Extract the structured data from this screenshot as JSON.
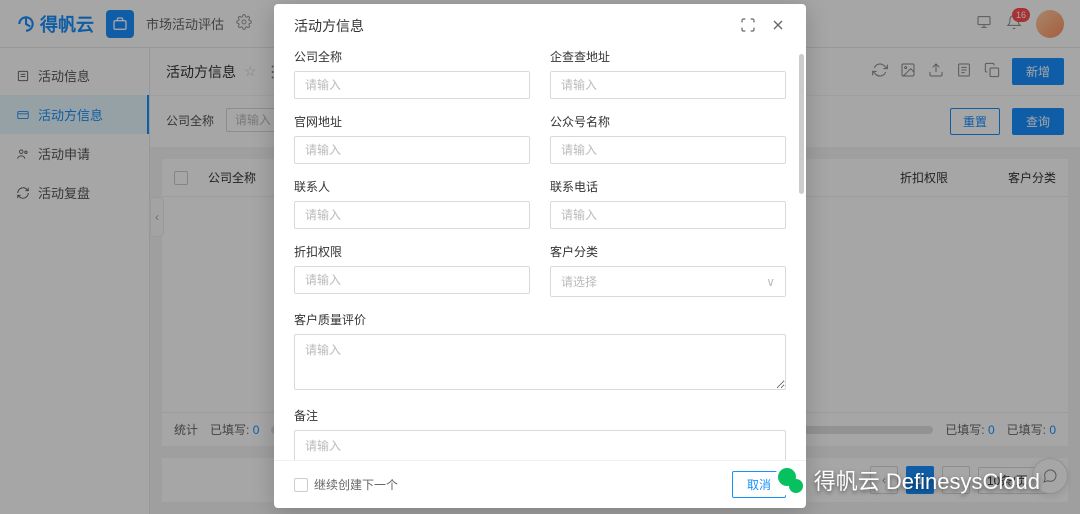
{
  "header": {
    "logo_text": "得帆云",
    "app_title": "市场活动评估",
    "badge_count": "16"
  },
  "sidebar": {
    "items": [
      {
        "label": "活动信息"
      },
      {
        "label": "活动方信息"
      },
      {
        "label": "活动申请"
      },
      {
        "label": "活动复盘"
      }
    ]
  },
  "page": {
    "title": "活动方信息",
    "new_button": "新增",
    "filter_label": "公司全称",
    "filter_placeholder": "请输入",
    "reset_button": "重置",
    "search_button": "查询"
  },
  "table": {
    "columns": {
      "company_name": "公司全称",
      "discount_perm": "折扣权限",
      "customer_cat": "客户分类"
    },
    "stats_label": "统计",
    "filled_label": "已填写:",
    "filled_count": "0"
  },
  "pagination": {
    "current": "1",
    "page_size": "10条/页"
  },
  "modal": {
    "title": "活动方信息",
    "fields": {
      "company_name": {
        "label": "公司全称",
        "placeholder": "请输入"
      },
      "qichacha_url": {
        "label": "企查查地址",
        "placeholder": "请输入"
      },
      "official_url": {
        "label": "官网地址",
        "placeholder": "请输入"
      },
      "wechat_name": {
        "label": "公众号名称",
        "placeholder": "请输入"
      },
      "contact": {
        "label": "联系人",
        "placeholder": "请输入"
      },
      "contact_phone": {
        "label": "联系电话",
        "placeholder": "请输入"
      },
      "discount_perm": {
        "label": "折扣权限",
        "placeholder": "请输入"
      },
      "customer_cat": {
        "label": "客户分类",
        "placeholder": "请选择"
      },
      "quality_review": {
        "label": "客户质量评价",
        "placeholder": "请输入"
      },
      "remarks": {
        "label": "备注",
        "placeholder": "请输入"
      }
    },
    "continue_label": "继续创建下一个",
    "cancel_button": "取消"
  },
  "watermark": "得帆云 DefinesysCloud"
}
